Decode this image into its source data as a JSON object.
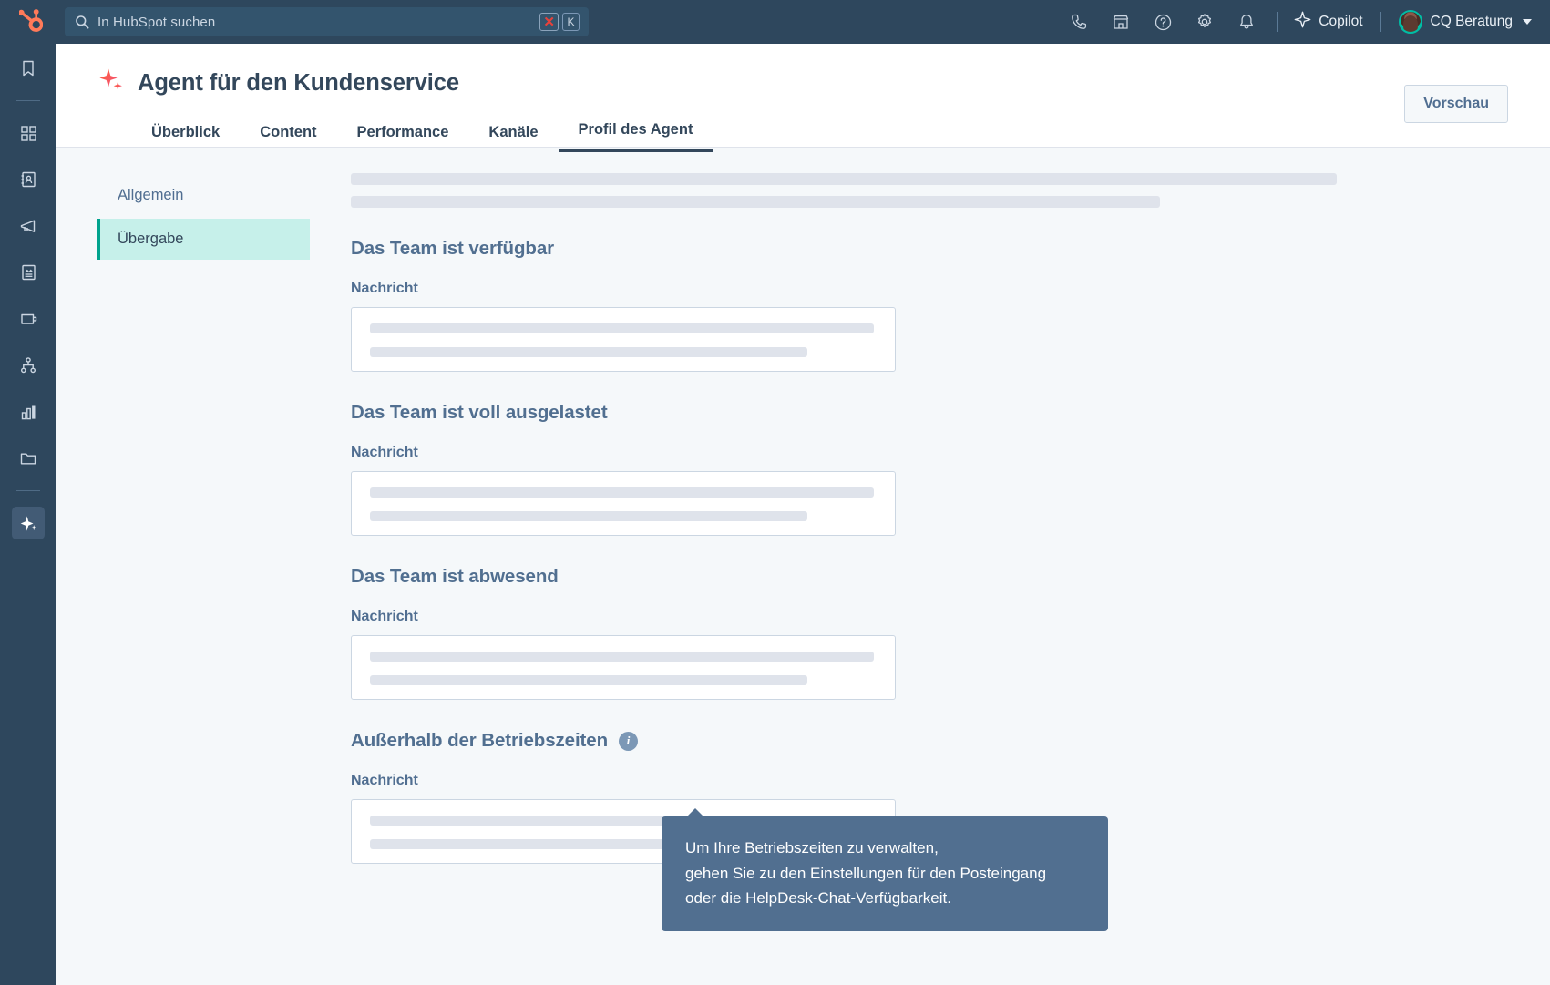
{
  "topbar": {
    "logo_icon": "hubspot-logo-icon",
    "search": {
      "placeholder": "In HubSpot suchen",
      "icon": "search-icon",
      "shortcut_modifier": "✕",
      "shortcut_key": "K"
    },
    "icons": [
      {
        "name": "phone-icon",
        "label": "Anrufe"
      },
      {
        "name": "marketplace-icon",
        "label": "Marketplace"
      },
      {
        "name": "help-icon",
        "label": "Hilfe"
      },
      {
        "name": "gear-icon",
        "label": "Einstellungen"
      },
      {
        "name": "bell-icon",
        "label": "Benachrichtigungen"
      }
    ],
    "copilot": {
      "label": "Copilot",
      "icon": "sparkle-icon"
    },
    "account": {
      "name": "CQ Beratung",
      "avatar": "user-avatar",
      "caret": "chevron-down-icon"
    }
  },
  "rail": {
    "items": [
      {
        "name": "bookmark-icon",
        "label": "Lesezeichen",
        "active": false
      },
      {
        "name": "divider-1",
        "divider": true
      },
      {
        "name": "apps-grid-icon",
        "label": "Arbeitsbereiche",
        "active": false
      },
      {
        "name": "contacts-icon",
        "label": "CRM",
        "active": false
      },
      {
        "name": "megaphone-icon",
        "label": "Marketing",
        "active": false
      },
      {
        "name": "content-icon",
        "label": "Content",
        "active": false
      },
      {
        "name": "wallet-icon",
        "label": "Commerce",
        "active": false
      },
      {
        "name": "automation-icon",
        "label": "Automatisierung",
        "active": false
      },
      {
        "name": "reporting-icon",
        "label": "Reporting",
        "active": false
      },
      {
        "name": "library-folder-icon",
        "label": "Bibliothek",
        "active": false
      },
      {
        "name": "divider-2",
        "divider": true
      },
      {
        "name": "ai-sparkle-icon",
        "label": "KI-Agent",
        "active": true
      }
    ]
  },
  "header": {
    "sparkle_icon": "breeze-sparkle-icon",
    "title": "Agent für den Kundenservice",
    "preview_button": "Vorschau",
    "tabs": [
      {
        "label": "Überblick",
        "active": false
      },
      {
        "label": "Content",
        "active": false
      },
      {
        "label": "Performance",
        "active": false
      },
      {
        "label": "Kanäle",
        "active": false
      },
      {
        "label": "Profil des Agent",
        "active": true
      }
    ]
  },
  "subnav": {
    "items": [
      {
        "label": "Allgemein",
        "active": false
      },
      {
        "label": "Übergabe",
        "active": true
      }
    ]
  },
  "content": {
    "field_label": "Nachricht",
    "sections": [
      {
        "heading": "Das Team ist verfügbar",
        "has_info": false
      },
      {
        "heading": "Das Team ist voll ausgelastet",
        "has_info": false
      },
      {
        "heading": "Das Team ist abwesend",
        "has_info": false
      },
      {
        "heading": "Außerhalb der Betriebszeiten",
        "has_info": true
      }
    ]
  },
  "tooltip": {
    "text": "Um Ihre Betriebszeiten zu verwalten, gehen Sie zu den Einstellungen für den Posteingang oder die HelpDesk-Chat-Verfügbarkeit.",
    "line1": "Um Ihre Betriebszeiten zu verwalten,",
    "line2": "gehen Sie zu den Einstellungen für den Posteingang",
    "line3": "oder die HelpDesk-Chat-Verfügbarkeit."
  },
  "colors": {
    "nav_bg": "#2e475d",
    "page_bg": "#f5f8fa",
    "accent_teal": "#00a38d",
    "active_subnav_bg": "#c6f0ea",
    "heading": "#516f90",
    "tooltip_bg": "#516f90",
    "brand_orange": "#ff7a59"
  }
}
